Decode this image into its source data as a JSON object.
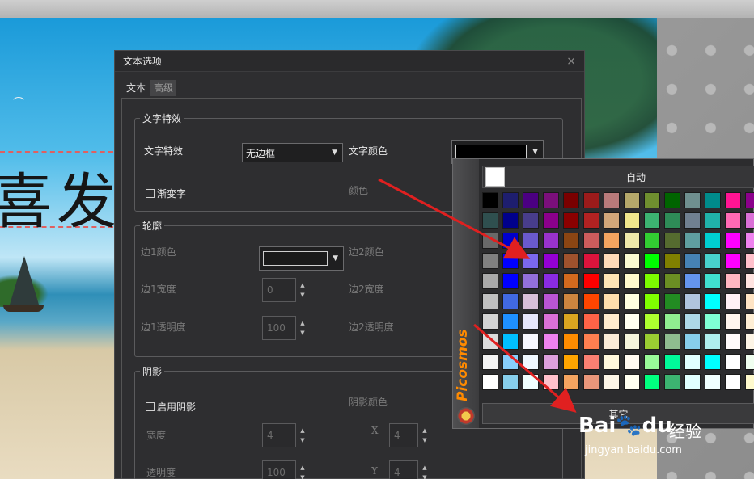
{
  "canvas": {
    "text": "喜发"
  },
  "dialog": {
    "title": "文本选项",
    "close": "×",
    "tabs": [
      {
        "label": "文本"
      },
      {
        "label": "高级"
      }
    ],
    "effects": {
      "title": "文字特效",
      "effect_label": "文字特效",
      "effect_value": "无边框",
      "color_label": "文字颜色",
      "color_value": "#000000",
      "gradient_label": "渐变字",
      "gradient_color_label": "颜色"
    },
    "outline": {
      "title": "轮廓",
      "edge1_color_label": "边1颜色",
      "edge1_color_value": "#000000",
      "edge2_color_label": "边2颜色",
      "edge1_width_label": "边1宽度",
      "edge1_width_value": "0",
      "edge2_width_label": "边2宽度",
      "edge1_opacity_label": "边1透明度",
      "edge1_opacity_value": "100",
      "edge2_opacity_label": "边2透明度"
    },
    "shadow": {
      "title": "阴影",
      "enable_label": "启用阴影",
      "color_label": "阴影颜色",
      "width_label": "宽度",
      "width_value": "4",
      "x_label": "X",
      "x_value": "4",
      "opacity_label": "透明度",
      "opacity_value": "100",
      "y_label": "Y",
      "y_value": "4"
    }
  },
  "color_popup": {
    "brand": "Picosmos",
    "auto_label": "自动",
    "auto_color": "#ffffff",
    "other_label": "其它",
    "colors": [
      [
        "#000000",
        "#1e1e6e",
        "#4b0082",
        "#7b0f7b",
        "#7a0000",
        "#9b1b1b",
        "#b87a7a",
        "#b5a86a",
        "#6f8f2f",
        "#006400",
        "#6f8f8f",
        "#008b8b",
        "#ff1493",
        "#8b008b"
      ],
      [
        "#2f4f4f",
        "#00008b",
        "#483d8b",
        "#8b008b",
        "#8b0000",
        "#b22222",
        "#d2a679",
        "#f0e68c",
        "#3cb371",
        "#2e8b57",
        "#708090",
        "#20b2aa",
        "#ff69b4",
        "#da70d6"
      ],
      [
        "#696969",
        "#0000cd",
        "#6a5acd",
        "#9932cc",
        "#8b4513",
        "#cd5c5c",
        "#f4a460",
        "#eee8aa",
        "#32cd32",
        "#556b2f",
        "#5f9ea0",
        "#00ced1",
        "#ff00ff",
        "#ee82ee"
      ],
      [
        "#808080",
        "#0000ff",
        "#7b68ee",
        "#9400d3",
        "#a0522d",
        "#dc143c",
        "#ffdab9",
        "#fafad2",
        "#00ff00",
        "#808000",
        "#4682b4",
        "#48d1cc",
        "#ff00ff",
        "#ffc0cb"
      ],
      [
        "#a9a9a9",
        "#0000ff",
        "#9370db",
        "#8a2be2",
        "#d2691e",
        "#ff0000",
        "#ffe4b5",
        "#fffacd",
        "#7cfc00",
        "#6b8e23",
        "#6495ed",
        "#40e0d0",
        "#ffb6c1",
        "#ffe4e1"
      ],
      [
        "#c0c0c0",
        "#4169e1",
        "#d8bfd8",
        "#ba55d3",
        "#cd853f",
        "#ff4500",
        "#ffdead",
        "#ffffe0",
        "#7fff00",
        "#228b22",
        "#b0c4de",
        "#00ffff",
        "#fff0f5",
        "#ffe4c4"
      ],
      [
        "#d3d3d3",
        "#1e90ff",
        "#e6e6fa",
        "#da70d6",
        "#daa520",
        "#ff6347",
        "#ffebcd",
        "#fffff0",
        "#adff2f",
        "#90ee90",
        "#add8e6",
        "#7fffd4",
        "#fff5ee",
        "#ffefd5"
      ],
      [
        "#dcdcdc",
        "#00bfff",
        "#f8f8ff",
        "#ee82ee",
        "#ff8c00",
        "#ff7f50",
        "#faebd7",
        "#f5f5dc",
        "#9acd32",
        "#8fbc8f",
        "#87ceeb",
        "#afeeee",
        "#fffafa",
        "#fdf5e6"
      ],
      [
        "#f5f5f5",
        "#87cefa",
        "#f0f8ff",
        "#dda0dd",
        "#ffa500",
        "#fa8072",
        "#fff8dc",
        "#fffaf0",
        "#98fb98",
        "#00fa9a",
        "#e0ffff",
        "#00ffff",
        "#ffffff",
        "#f0fff0"
      ],
      [
        "#ffffff",
        "#87ceeb",
        "#f0ffff",
        "#ffc0cb",
        "#f4a460",
        "#e9967a",
        "#fdf5e6",
        "#fffff0",
        "#00ff7f",
        "#3cb371",
        "#e0ffff",
        "#f0ffff",
        "#ffffff",
        "#fffacd"
      ]
    ]
  },
  "watermark": {
    "brand": "Bai",
    "suffix": "du",
    "cn": "经验",
    "url": "jingyan.baidu.com"
  }
}
